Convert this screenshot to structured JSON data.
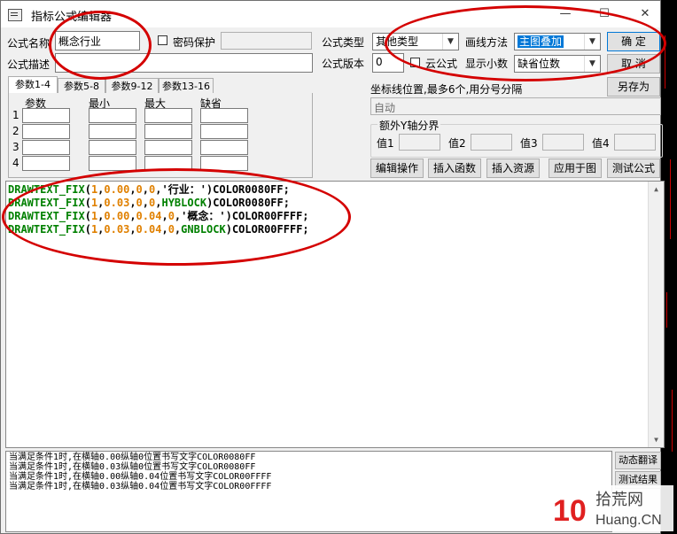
{
  "window": {
    "title": "指标公式编辑器",
    "minimize": "—",
    "maximize": "☐",
    "close": "✕"
  },
  "formula": {
    "name_label": "公式名称",
    "name_value": "概念行业",
    "password_label": "密码保护",
    "desc_label": "公式描述",
    "desc_value": "",
    "type_label": "公式类型",
    "type_value": "其他类型",
    "draw_label": "画线方法",
    "draw_value": "主图叠加",
    "version_label": "公式版本",
    "version_value": "0",
    "cloud_label": "云公式",
    "decimal_label": "显示小数",
    "decimal_value": "缺省位数"
  },
  "buttons": {
    "ok": "确  定",
    "cancel": "取  消",
    "save_as": "另存为",
    "edit_op": "编辑操作",
    "insert_func": "插入函数",
    "insert_res": "插入资源",
    "apply_chart": "应用于图",
    "test_formula": "测试公式",
    "dyn_translate": "动态翻译",
    "test_result": "测试结果"
  },
  "param_tabs": [
    "参数1-4",
    "参数5-8",
    "参数9-12",
    "参数13-16"
  ],
  "param_headers": [
    "参数",
    "最小",
    "最大",
    "缺省"
  ],
  "param_rows": [
    "1",
    "2",
    "3",
    "4"
  ],
  "axis": {
    "label": "坐标线位置,最多6个,用分号分隔",
    "value": "自动",
    "extra_group": "额外Y轴分界",
    "values": [
      "值1",
      "值2",
      "值3",
      "值4"
    ]
  },
  "code": [
    [
      [
        "fn",
        "DRAWTEXT_FIX"
      ],
      [
        "p",
        "("
      ],
      [
        "num",
        "1"
      ],
      [
        "p",
        ","
      ],
      [
        "num",
        "0.00"
      ],
      [
        "p",
        ","
      ],
      [
        "num",
        "0"
      ],
      [
        "p",
        ","
      ],
      [
        "num",
        "0"
      ],
      [
        "p",
        ",'行业：')COLOR0080FF;"
      ]
    ],
    [
      [
        "fn",
        "DRAWTEXT_FIX"
      ],
      [
        "p",
        "("
      ],
      [
        "num",
        "1"
      ],
      [
        "p",
        ","
      ],
      [
        "num",
        "0.03"
      ],
      [
        "p",
        ","
      ],
      [
        "num",
        "0"
      ],
      [
        "p",
        ","
      ],
      [
        "num",
        "0"
      ],
      [
        "p",
        ","
      ],
      [
        "fn",
        "HYBLOCK"
      ],
      [
        "p",
        ")COLOR0080FF;"
      ]
    ],
    [
      [
        "fn",
        "DRAWTEXT_FIX"
      ],
      [
        "p",
        "("
      ],
      [
        "num",
        "1"
      ],
      [
        "p",
        ","
      ],
      [
        "num",
        "0.00"
      ],
      [
        "p",
        ","
      ],
      [
        "num",
        "0.04"
      ],
      [
        "p",
        ","
      ],
      [
        "num",
        "0"
      ],
      [
        "p",
        ",'概念：')COLOR00FFFF;"
      ]
    ],
    [
      [
        "fn",
        "DRAWTEXT_FIX"
      ],
      [
        "p",
        "("
      ],
      [
        "num",
        "1"
      ],
      [
        "p",
        ","
      ],
      [
        "num",
        "0.03"
      ],
      [
        "p",
        ","
      ],
      [
        "num",
        "0.04"
      ],
      [
        "p",
        ","
      ],
      [
        "num",
        "0"
      ],
      [
        "p",
        ","
      ],
      [
        "fn",
        "GNBLOCK"
      ],
      [
        "p",
        ")COLOR00FFFF;"
      ]
    ]
  ],
  "output": [
    "当满足条件1时,在横轴0.00纵轴0位置书写文字COLOR0080FF",
    "当满足条件1时,在横轴0.03纵轴0位置书写文字COLOR0080FF",
    "当满足条件1时,在横轴0.00纵轴0.04位置书写文字COLOR00FFFF",
    "当满足条件1时,在横轴0.03纵轴0.04位置书写文字COLOR00FFFF"
  ],
  "watermark": {
    "number": "10",
    "text_cn": "拾荒网",
    "text_en": "Huang.CN"
  },
  "colors": {
    "annotation": "#d40000",
    "code_fn": "#008000",
    "code_num": "#e08000",
    "select_hl": "#0078d7"
  }
}
